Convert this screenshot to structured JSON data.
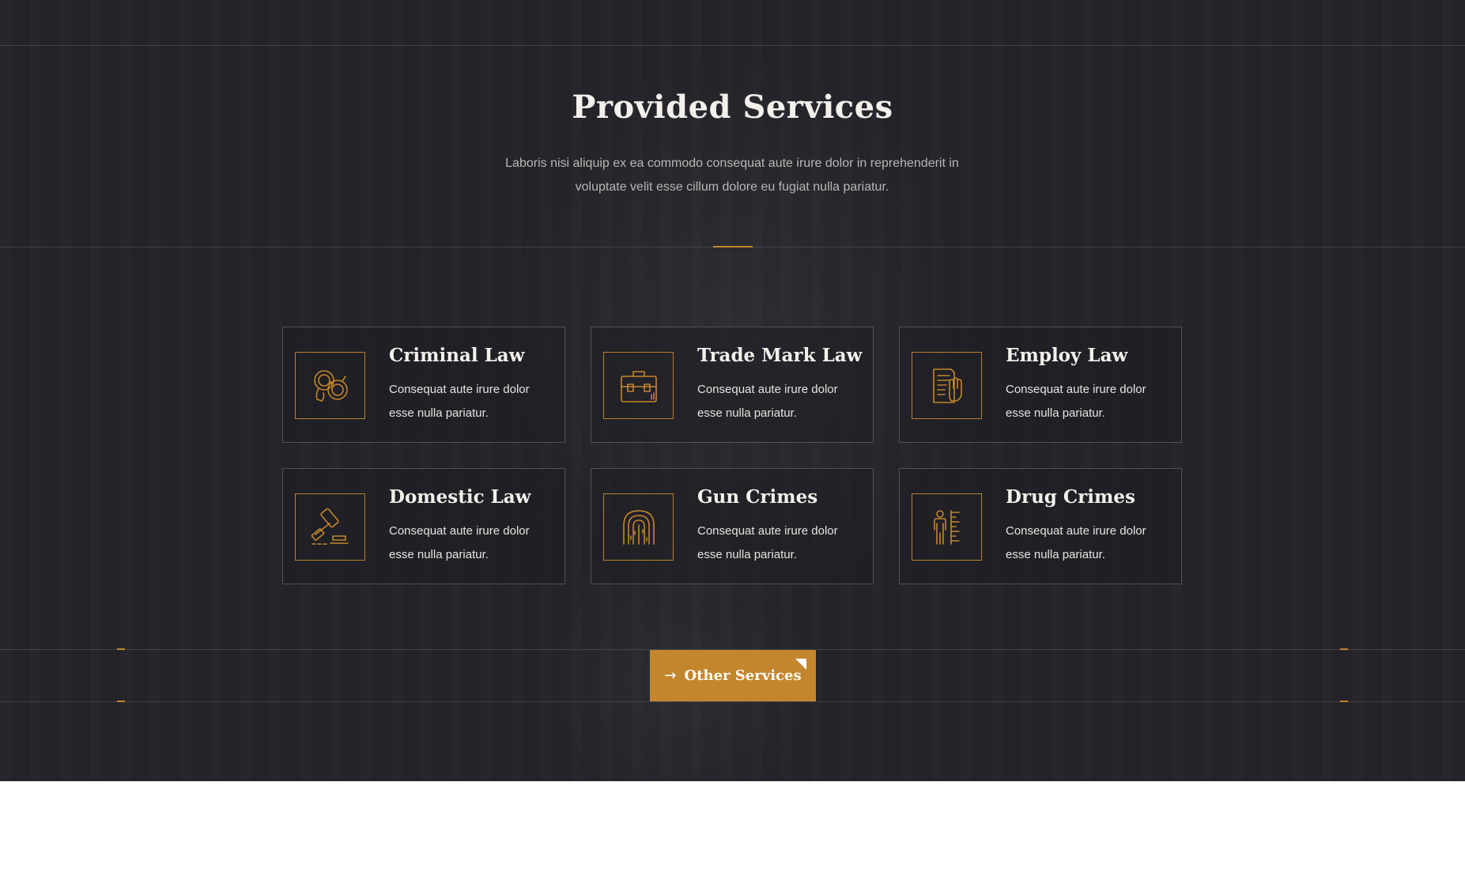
{
  "section": {
    "title": "Provided Services",
    "subtitle": "Laboris nisi aliquip ex ea commodo consequat aute irure dolor in reprehenderit in voluptate velit esse cillum dolore eu fugiat nulla pariatur."
  },
  "services": [
    {
      "title": "Criminal Law",
      "text": "Consequat aute irure dolor esse nulla pariatur.",
      "icon": "handcuffs-icon"
    },
    {
      "title": "Trade Mark Law",
      "text": "Consequat aute irure dolor esse nulla pariatur.",
      "icon": "briefcase-icon"
    },
    {
      "title": "Employ Law",
      "text": "Consequat aute irure dolor esse nulla pariatur.",
      "icon": "document-fist-icon"
    },
    {
      "title": "Domestic Law",
      "text": "Consequat aute irure dolor esse nulla pariatur.",
      "icon": "gavel-icon"
    },
    {
      "title": "Gun Crimes",
      "text": "Consequat aute irure dolor esse nulla pariatur.",
      "icon": "fingerprint-icon"
    },
    {
      "title": "Drug Crimes",
      "text": "Consequat aute irure dolor esse nulla pariatur.",
      "icon": "height-chart-person-icon"
    }
  ],
  "cta": {
    "label": "Other Services",
    "icon": "arrow-right-icon"
  },
  "colors": {
    "background": "#242329",
    "accent": "#c4862c",
    "title": "#f4f1ec",
    "text": "#b9b7b4"
  }
}
